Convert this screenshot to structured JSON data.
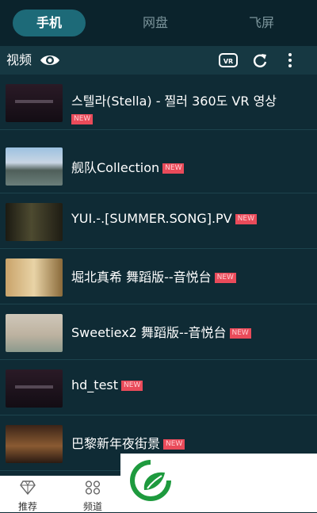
{
  "tabs": [
    {
      "label": "手机"
    },
    {
      "label": "网盘"
    },
    {
      "label": "飞屏"
    }
  ],
  "toolbar": {
    "title": "视频",
    "icons": [
      "eye-icon",
      "vr-icon",
      "refresh-icon",
      "more-icon"
    ],
    "vr_label": "VR"
  },
  "videos": [
    {
      "title": "스텔라(Stella) - 찔러 360도 VR 영상",
      "badge": "NEW"
    },
    {
      "title": "舰队Collection",
      "badge": "NEW"
    },
    {
      "title": "YUI.-.[SUMMER.SONG].PV",
      "badge": "NEW"
    },
    {
      "title": "堀北真希 舞蹈版--音悦台",
      "badge": "NEW"
    },
    {
      "title": "Sweetiex2 舞蹈版--音悦台",
      "badge": "NEW"
    },
    {
      "title": "hd_test",
      "badge": "NEW"
    },
    {
      "title": "巴黎新年夜街景",
      "badge": "NEW"
    }
  ],
  "bottom_nav": [
    {
      "label": "推荐",
      "icon": "diamond-icon"
    },
    {
      "label": "频道",
      "icon": "grid-icon"
    }
  ],
  "colors": {
    "background": "#0f2b35",
    "accent": "#1d6a78",
    "badge": "#e94b5a",
    "logo_green": "#1e9a3e"
  }
}
